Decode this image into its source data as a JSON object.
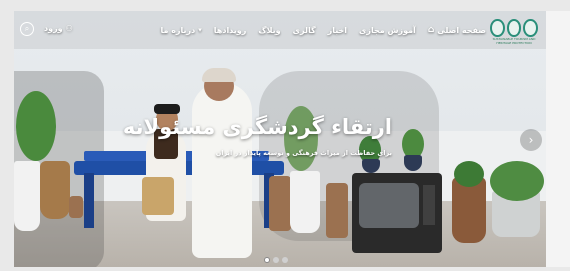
{
  "nav": {
    "items": [
      {
        "label": "صفحه اصلی",
        "icon": "home-icon"
      },
      {
        "label": "آموزش مجازی"
      },
      {
        "label": "اخبار"
      },
      {
        "label": "گالری"
      },
      {
        "label": "وبلاگ"
      },
      {
        "label": "رویدادها"
      },
      {
        "label": "درباره ما",
        "icon": "chevron-down-icon"
      }
    ],
    "login_label": "ورود",
    "login_icon": "user-icon",
    "search_icon": "search-icon"
  },
  "logo": {
    "text": "SUSTAINABLE TOURISM AND HERITAGE PROTECTION"
  },
  "hero": {
    "title": "ارتقاء گردشگری مسئولانه",
    "subtitle": "برای حفاظت از میراث فرهنگی و توسعه پایدار در ایران",
    "next_icon": "chevron-right-icon"
  },
  "slider": {
    "total_slides": 3,
    "active_index": 0
  },
  "colors": {
    "bench": "#1f4fa6",
    "logo_accent": "#2a8f7a",
    "text": "#ffffff"
  }
}
